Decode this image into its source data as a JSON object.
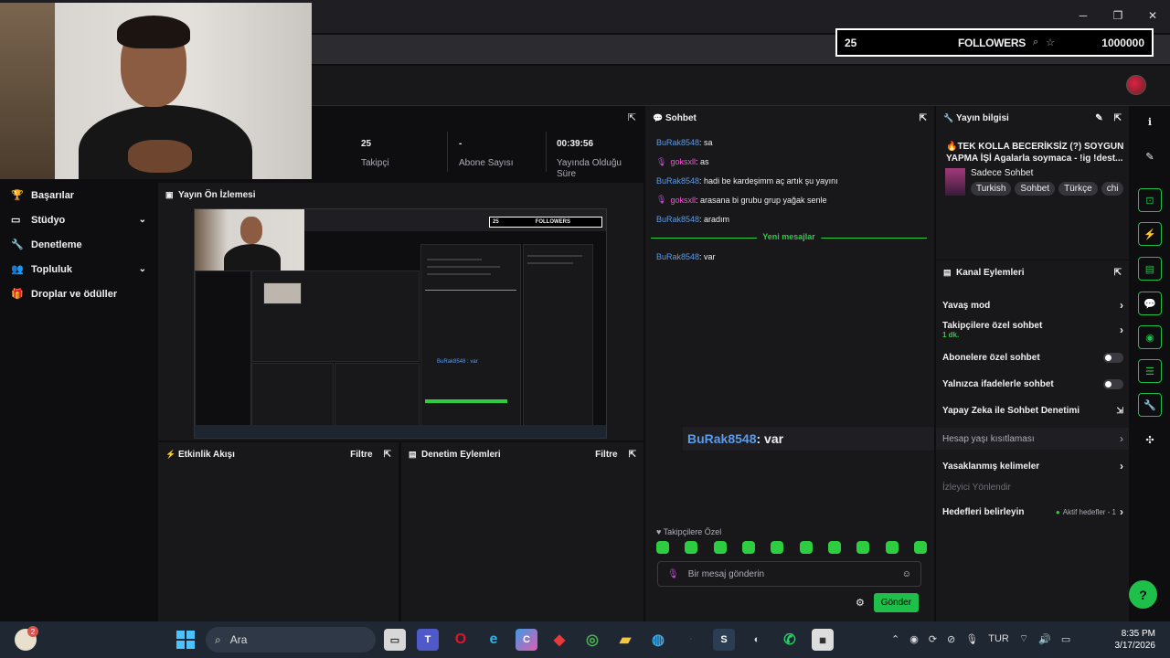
{
  "overlay": {
    "current": "25",
    "label": "FOLLOWERS",
    "goal": "1000000"
  },
  "window": {
    "minimize": "─",
    "maximize": "❐",
    "close": "✕"
  },
  "sidebar": {
    "items": [
      {
        "label": "Başarılar",
        "icon": "trophy-icon",
        "chev": ""
      },
      {
        "label": "Stüdyo",
        "icon": "studio-icon",
        "chev": "⌄"
      },
      {
        "label": "Denetleme",
        "icon": "wrench-icon",
        "chev": ""
      },
      {
        "label": "Topluluk",
        "icon": "community-icon",
        "chev": "⌄"
      },
      {
        "label": "Droplar ve ödüller",
        "icon": "gift-icon",
        "chev": ""
      }
    ]
  },
  "stats": [
    {
      "value": "25",
      "label": "Takipçi"
    },
    {
      "value": "-",
      "label": "Abone Sayısı"
    },
    {
      "value": "00:39:56",
      "label": "Yayında Olduğu Süre"
    }
  ],
  "preview": {
    "title": "Yayın Ön İzlemesi"
  },
  "activity": {
    "title": "Etkinlik Akışı",
    "filter": "Filtre"
  },
  "moderation": {
    "title": "Denetim Eylemleri",
    "filter": "Filtre"
  },
  "chat": {
    "title": "Sohbet",
    "messages_before": [
      {
        "user": "BuRak8548",
        "text": ": sa",
        "color": "blue",
        "mic": false
      },
      {
        "user": "goksxll",
        "text": ": as",
        "color": "pink",
        "mic": true
      },
      {
        "user": "BuRak8548",
        "text": ": hadi be kardeşimm aç artık şu yayını",
        "color": "blue",
        "mic": false
      },
      {
        "user": "goksxll",
        "text": ": arasana bi grubu grup yağak senle",
        "color": "pink",
        "mic": true
      },
      {
        "user": "BuRak8548",
        "text": ": aradım",
        "color": "blue",
        "mic": false
      }
    ],
    "new_messages": "Yeni mesajlar",
    "messages_after": [
      {
        "user": "BuRak8548",
        "text": ": var",
        "color": "blue",
        "mic": false
      }
    ],
    "pinned": {
      "user": "BuRak8548",
      "text": " : var"
    },
    "followers_only": "♥ Takipçilere Özel",
    "placeholder": "Bir mesaj gönderin",
    "send": "Gönder"
  },
  "stream_info": {
    "title": "Yayın bilgisi",
    "stream_title": "🔥TEK KOLLA BECERİKSİZ (?) SOYGUN YAPMA İŞİ Agalarla soymaca - !ig !dest...",
    "category": "Sadece Sohbet",
    "tags": [
      "Turkish",
      "Sohbet",
      "Türkçe",
      "chi"
    ]
  },
  "channel_actions": {
    "title": "Kanal Eylemleri",
    "slow_mode": "Yavaş mod",
    "followers_chat": "Takipçilere özel sohbet",
    "followers_chat_sub": "1 dk.",
    "subs_chat": "Abonelere özel sohbet",
    "emote_chat": "Yalnızca ifadelerle sohbet",
    "ai_moderation": "Yapay Zeka ile Sohbet Denetimi",
    "age_restriction": "Hesap yaşı kısıtlaması",
    "banned_words": "Yasaklanmış kelimeler",
    "viewer_redirect": "İzleyici Yönlendir",
    "goals": "Hedefleri belirleyin",
    "active_goals": "Aktif hedefler - 1"
  },
  "taskbar": {
    "search": "Ara",
    "weather_badge": "2",
    "lang": "TUR",
    "time": "8:35 PM",
    "date": "3/17/2026"
  },
  "colors": {
    "accent": "#1ec04a",
    "username_blue": "#5c9be8",
    "username_pink": "#ff4fd8",
    "panel": "#18181b",
    "bg": "#0e0e10"
  }
}
